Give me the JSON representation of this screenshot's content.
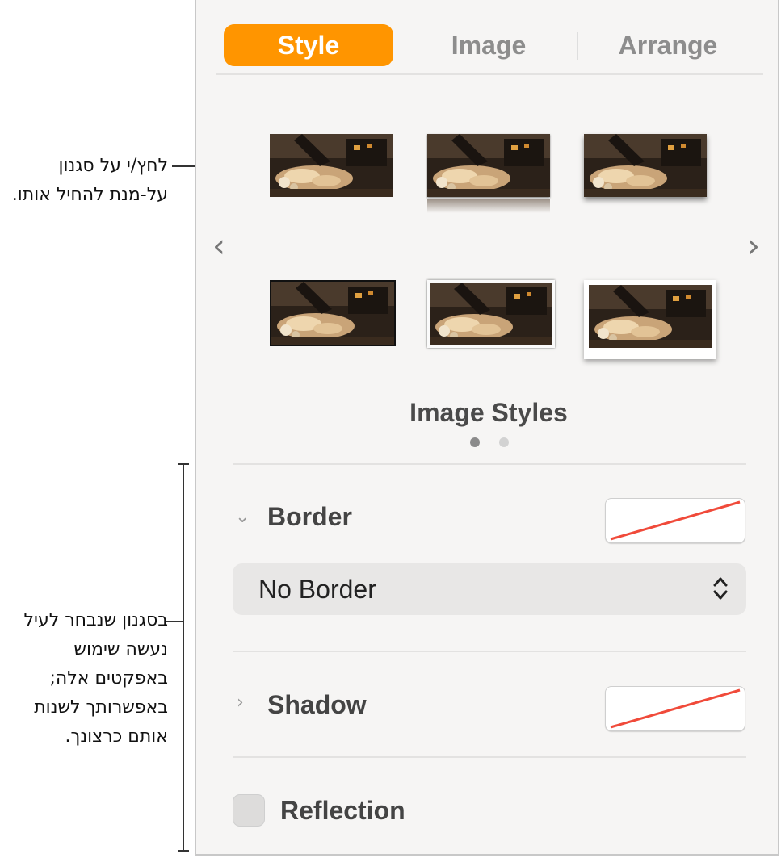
{
  "tabs": [
    {
      "label": "Style",
      "active": true
    },
    {
      "label": "Image",
      "active": false
    },
    {
      "label": "Arrange",
      "active": false
    }
  ],
  "image_styles": {
    "title": "Image Styles",
    "page_count": 2,
    "current_page": 1
  },
  "border": {
    "label": "Border",
    "expanded": true,
    "color": "none",
    "style_value": "No Border"
  },
  "shadow": {
    "label": "Shadow",
    "expanded": false,
    "color": "none"
  },
  "reflection": {
    "label": "Reflection",
    "checked": false
  },
  "callouts": {
    "style_tip": "לחץ/י על סגנון על-מנת להחיל אותו.",
    "effects_tip": "בסגנון שנבחר לעיל נעשה שימוש באפקטים אלה; באפשרותך לשנות אותם כרצונך."
  },
  "colors": {
    "accent": "#ff9500",
    "none_swatch_slash": "#f04a3a"
  }
}
